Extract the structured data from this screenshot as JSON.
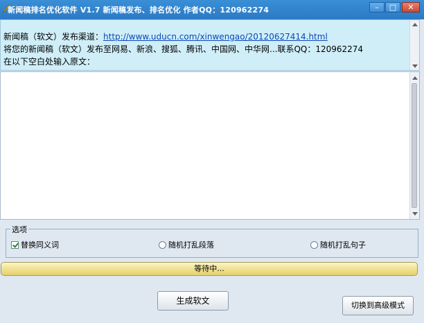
{
  "window": {
    "title": "新闻稿排名优化软件 V1.7     新闻稿发布、排名优化   作者QQ：120962274",
    "minimize_label": "–",
    "maximize_label": "□",
    "close_label": "✕"
  },
  "info": {
    "line1_prefix": "新闻稿（软文）发布渠道：",
    "line1_link": "http://www.uducn.com/xinwengao/20120627414.html",
    "line2": "将您的新闻稿（软文）发布至网易、新浪、搜狐、腾讯、中国网、中华网...联系QQ：120962274",
    "line3": "在以下空白处输入原文："
  },
  "editor": {
    "value": ""
  },
  "options": {
    "legend": "选项",
    "items": [
      {
        "label": "替换同义词",
        "type": "checkbox",
        "checked": true
      },
      {
        "label": "随机打乱段落",
        "type": "radio",
        "checked": false
      },
      {
        "label": "随机打乱句子",
        "type": "radio",
        "checked": false
      }
    ]
  },
  "progress": {
    "label": "等待中...",
    "fraction": 1.0
  },
  "buttons": {
    "generate": "生成软文",
    "advanced": "切换到高级模式"
  }
}
